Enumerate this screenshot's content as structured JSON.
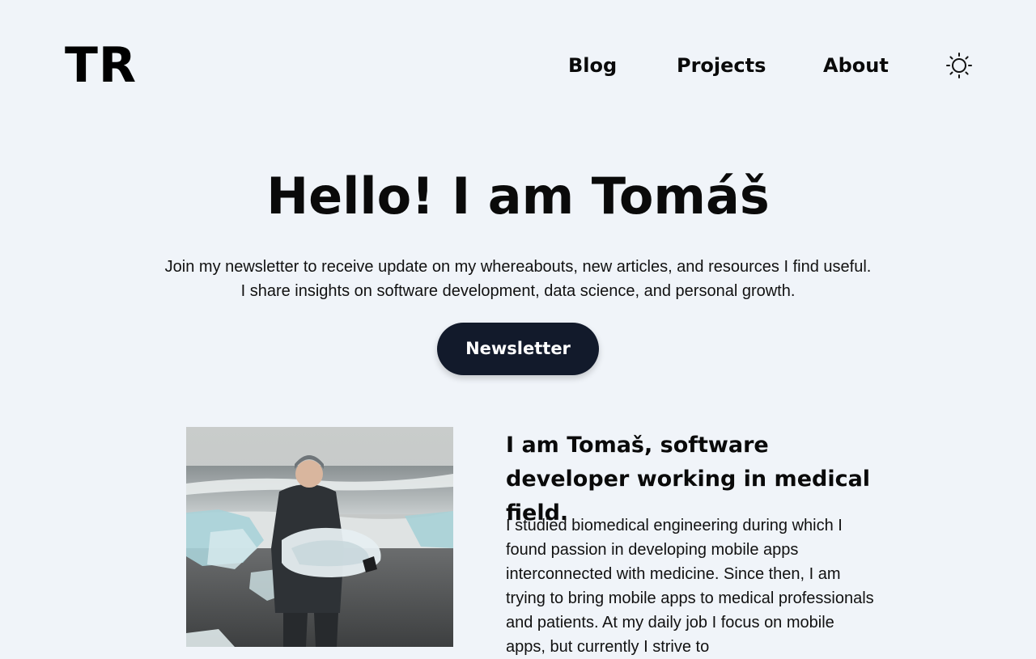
{
  "header": {
    "logo": "TR",
    "nav": [
      "Blog",
      "Projects",
      "About"
    ],
    "theme_toggle_icon": "sun-icon"
  },
  "hero": {
    "title": "Hello! I am Tomáš",
    "text": "Join my newsletter to receive update on my whereabouts, new articles, and resources I find useful. I share insights on software development, data science, and personal growth.",
    "button_label": "Newsletter"
  },
  "about": {
    "heading": "I am Tomaš, software developer working in medical field.",
    "body": "I studied biomedical engineering during which I found passion in developing mobile apps interconnected with medicine. Since then, I am trying to bring mobile apps to medical professionals and patients. At my daily job I focus on mobile apps, but currently I strive to"
  },
  "colors": {
    "background": "#f0f4f9",
    "button": "#121a2b",
    "text": "#0a0a0a"
  }
}
